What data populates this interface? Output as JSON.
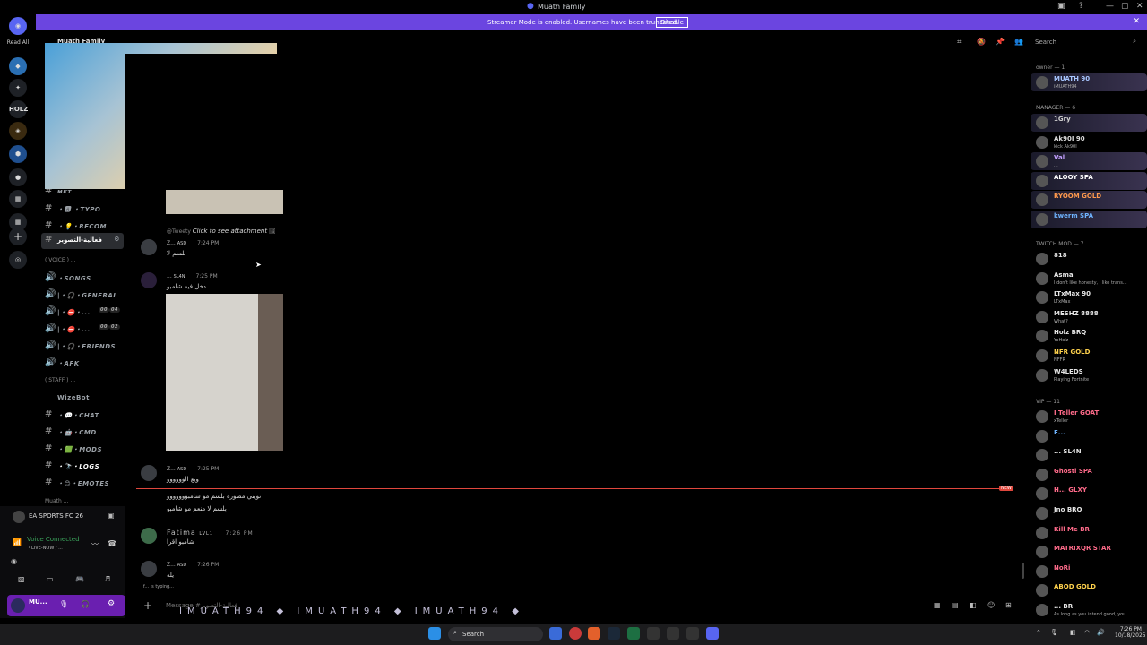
{
  "window": {
    "title": "Muath Family",
    "controls": [
      "—",
      "▢",
      "✕"
    ]
  },
  "banner": {
    "text": "Streamer Mode is enabled. Usernames have been truncated.",
    "disable_label": "Disable"
  },
  "rail": {
    "read_all": "Read All",
    "servers": [
      "HOLZ"
    ]
  },
  "server": {
    "name": "Muath Family"
  },
  "channels": [
    {
      "label": "ᴍᴋᴛ",
      "type": "text"
    },
    {
      "label": "・🅰 ・TYPO",
      "type": "text"
    },
    {
      "label": "・💡・RECOM",
      "type": "text"
    },
    {
      "label": "فعالية-التصوير",
      "type": "text",
      "active": true
    }
  ],
  "voice_category": "( VOICE ) ...",
  "voice_channels": [
    {
      "label": "・SONGS"
    },
    {
      "label": "|・🎧・GENERAL"
    },
    {
      "label": "|・⛔・...",
      "badge1": "00",
      "badge2": "04"
    },
    {
      "label": "|・⛔・...",
      "badge1": "00",
      "badge2": "02"
    },
    {
      "label": "|・🎧・FRIENDS"
    },
    {
      "label": "・AFK"
    }
  ],
  "staff_category": "( STAFF ) ...",
  "staff_channels": [
    {
      "label": "WizeBot"
    },
    {
      "label": "・💬・CHAT"
    },
    {
      "label": "・🤖・CMD"
    },
    {
      "label": "・🟩・MODS"
    },
    {
      "label": "・🔭・LOGS"
    },
    {
      "label": "・😊・EMOTES"
    }
  ],
  "muath_category": "Muath ...",
  "messages": [
    {
      "reply": "@Tweety",
      "reply_text": "Click to see attachment",
      "author": "Z...",
      "tag": "ASD",
      "time": "7:24 PM",
      "text": "بلسم لا"
    },
    {
      "author": "...",
      "tag": "SL4N",
      "time": "7:25 PM",
      "text": "دخل فيه شامبو"
    },
    {
      "author": "Z...",
      "tag": "ASD",
      "time": "7:25 PM",
      "text": "ويع الوووووو"
    },
    {
      "text": "تويتي مصوره بلسم مو شامبووووووو"
    },
    {
      "text": "بلسم لا منعم مو شامبو"
    },
    {
      "author": "Fatima",
      "tag": "LVL1",
      "time": "7:26 PM",
      "text": "شامبو اقرا"
    },
    {
      "author": "Z...",
      "tag": "ASD",
      "time": "7:26 PM",
      "text": "يله"
    }
  ],
  "new_label": "NEW",
  "typing": "f... is typing...",
  "composer": {
    "placeholder": "Message #فعالية-التصوير"
  },
  "overlay_bar": "IMUATH94 ◆ IMUATH94 ◆ IMUATH94 ◆",
  "search": {
    "placeholder": "Search"
  },
  "members": {
    "groups": [
      {
        "label": "owner — 1",
        "items": [
          {
            "name": "MUATH",
            "badge": "90",
            "sub": "iMUATH94",
            "color": "#a8c6ff"
          }
        ]
      },
      {
        "label": "MANAGER — 6",
        "items": [
          {
            "name": "1Gry",
            "color": "#cfcfcf"
          },
          {
            "name": "Ak90I",
            "badge": "90",
            "sub": "kick Ak90I",
            "color": "#dddddd"
          },
          {
            "name": "Val",
            "sub": "...",
            "color": "#c4a1ff"
          },
          {
            "name": "ALOOY",
            "badge": "SPA",
            "color": "#ffffff"
          },
          {
            "name": "RYOOM",
            "badge": "GOLD",
            "color": "#ff9a4d"
          },
          {
            "name": "kwerm",
            "badge": "SPA",
            "color": "#6fb4ff"
          }
        ]
      },
      {
        "label": "TWITCH MOD — 7",
        "items": [
          {
            "name": "818",
            "color": "#e6e6e6"
          },
          {
            "name": "Asma",
            "sub": "I don't like honesty, I like trans...",
            "color": "#e6e6e6"
          },
          {
            "name": "LTxMax",
            "badge": "90",
            "sub": "LTxMax",
            "color": "#e6e6e6"
          },
          {
            "name": "MESHZ",
            "badge": "8888",
            "sub": "What?",
            "color": "#e6e6e6"
          },
          {
            "name": "Holz",
            "badge": "BRQ",
            "sub": "YoHolz",
            "color": "#e6e6e6"
          },
          {
            "name": "NFR",
            "badge": "GOLD",
            "sub": "NFFR",
            "color": "#ffd24d"
          },
          {
            "name": "W4LEDS",
            "sub": "Playing Fortnite",
            "color": "#e6e6e6"
          }
        ]
      },
      {
        "label": "VIP — 11",
        "items": [
          {
            "name": "I Teller",
            "badge": "GOAT",
            "sub": "xTeller",
            "color": "#ff6b8a"
          },
          {
            "name": "E...",
            "color": "#6fb4ff"
          },
          {
            "name": "...",
            "badge": "SL4N",
            "color": "#e6e6e6"
          },
          {
            "name": "Ghosti",
            "badge": "SPA",
            "color": "#ff6b8a"
          },
          {
            "name": "H...",
            "badge": "GLXY",
            "color": "#ff6b8a"
          },
          {
            "name": "Jno",
            "badge": "BRQ",
            "color": "#e6e6e6"
          },
          {
            "name": "Kill Me",
            "badge": "BR",
            "color": "#ff6b8a"
          },
          {
            "name": "MATRIXQR",
            "badge": "STAR",
            "color": "#ff6b8a"
          },
          {
            "name": "NoRi",
            "color": "#ff6b8a"
          },
          {
            "name": "ABOD",
            "badge": "GOLD",
            "color": "#ffd24d"
          },
          {
            "name": "...",
            "badge": "BR",
            "sub": "As long as you intend good, you ...",
            "color": "#e6e6e6"
          }
        ]
      }
    ]
  },
  "user_panel": {
    "game": "EA SPORTS FC 26",
    "voice": "Voice Connected",
    "voice_sub": "・LIVE-NOW / ...",
    "username": "MU..."
  },
  "taskbar": {
    "search": "Search",
    "time": "7:26 PM",
    "date": "10/18/2025"
  }
}
